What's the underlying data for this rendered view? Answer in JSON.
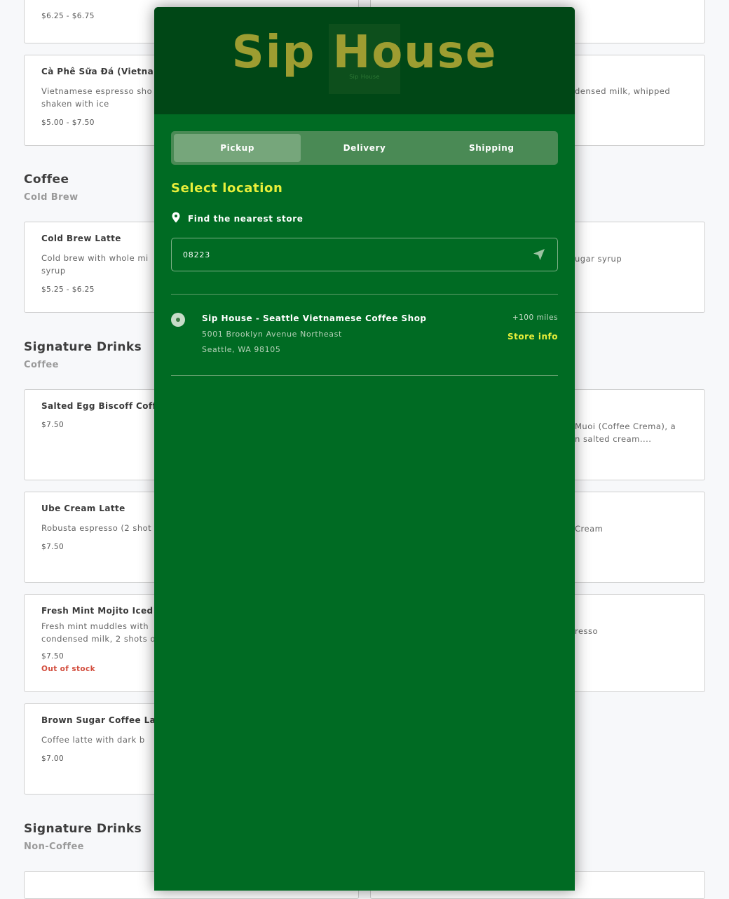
{
  "menu": {
    "cards_left": [
      {
        "name": "",
        "desc": "",
        "price": "$6.25 - $6.75",
        "out_of_stock": ""
      },
      {
        "name": "Cà Phê Sữa Đá (Vietname",
        "desc": "Vietnamese espresso sho\nshaken with ice",
        "price": "$5.00 - $7.50",
        "out_of_stock": ""
      },
      {
        "name": "Cold Brew Latte",
        "desc": "Cold brew with whole mi\nsyrup",
        "price": "$5.25 - $6.25",
        "out_of_stock": ""
      },
      {
        "name": "Salted Egg Biscoff Coff",
        "desc": "",
        "price": "$7.50",
        "out_of_stock": ""
      },
      {
        "name": "Ube Cream Latte",
        "desc": "Robusta espresso (2 shot",
        "price": "$7.50",
        "out_of_stock": ""
      },
      {
        "name": "Fresh Mint Mojito Iced C",
        "desc": "Fresh mint muddles with\ncondensed milk, 2 shots o",
        "price": "$7.50",
        "out_of_stock": "Out of stock"
      },
      {
        "name": "Brown Sugar Coffee Lat",
        "desc": "Coffee latte with dark b",
        "price": "$7.00",
        "out_of_stock": ""
      }
    ],
    "right_fragments": [
      "densed milk, whipped",
      "ugar syrup",
      "Muoi (Coffee Crema), a\nn salted cream....",
      "Cream",
      "resso"
    ],
    "sections": [
      {
        "title": "Coffee",
        "sub": "Cold Brew"
      },
      {
        "title": "Signature Drinks",
        "sub": "Coffee"
      },
      {
        "title": "Signature Drinks",
        "sub": "Non-Coffee"
      }
    ]
  },
  "modal": {
    "logo_text": "Sip House",
    "logo_small": "Sip House",
    "tabs": [
      "Pickup",
      "Delivery",
      "Shipping"
    ],
    "active_tab": "Pickup",
    "select_title": "Select location",
    "find_label": "Find the nearest store",
    "search_value": "08223",
    "store": {
      "name": "Sip House - Seattle Vietnamese Coffee Shop",
      "address_line1": "5001 Brooklyn Avenue Northeast",
      "address_line2": "Seattle, WA 98105",
      "distance": "+100 miles",
      "info_link": "Store info"
    }
  },
  "colors": {
    "modal_bg": "#006b23",
    "header_bg": "#004716",
    "accent_yellow": "#e8ef3a",
    "logo": "#a6a233",
    "out_of_stock": "#d24c3c"
  }
}
